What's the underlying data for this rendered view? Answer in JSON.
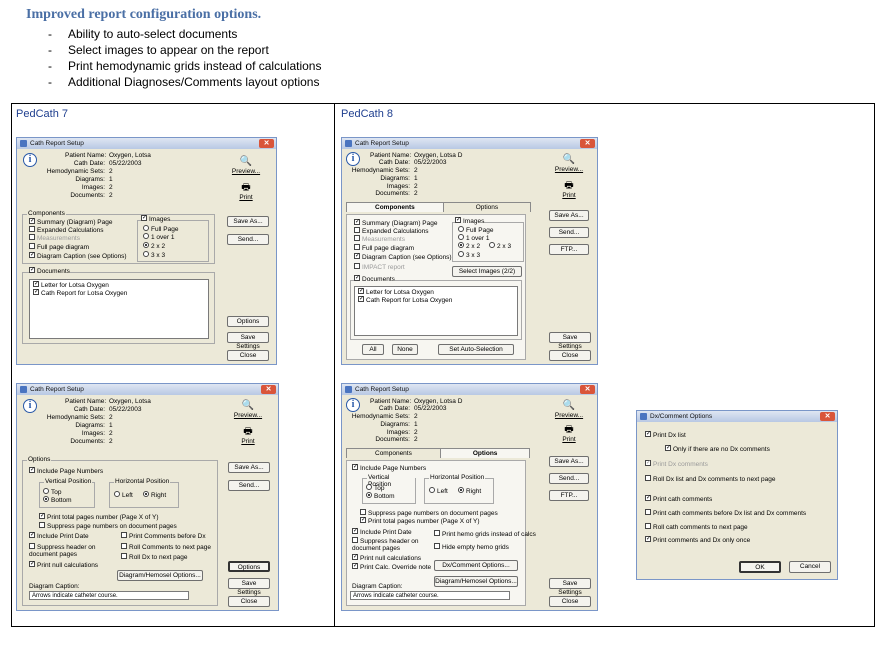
{
  "heading": "Improved report configuration options.",
  "bullets": [
    "Ability to auto-select documents",
    "Select images to appear on the report",
    "Print hemodynamic grids instead of calculations",
    "Additional Diagnoses/Comments layout options"
  ],
  "columns": {
    "left": "PedCath 7",
    "right": "PedCath 8"
  },
  "patient": {
    "name_l": "Patient Name:",
    "name7": "Oxygen, Lotsa",
    "name8": "Oxygen, Lotsa D",
    "date_l": "Cath Date:",
    "date": "05/22/2003",
    "hemo_l": "Hemodynamic Sets:",
    "hemo": "2",
    "diag_l": "Diagrams:",
    "diag": "1",
    "img_l": "Images:",
    "img": "2",
    "doc_l": "Documents:",
    "doc": "2"
  },
  "dialog_title": "Cath Report Setup",
  "buttons": {
    "preview": "Preview...",
    "print": "Print",
    "save_as": "Save As...",
    "send": "Send...",
    "ftp": "FTP...",
    "options": "Options",
    "save_settings": "Save Settings",
    "close": "Close",
    "all": "All",
    "none": "None",
    "auto_sel": "Set Auto-Selection",
    "select_images": "Select Images (2/2)",
    "dx_comment": "Dx/Comment Options...",
    "diag_hemo": "Diagram/Hemosel Options..."
  },
  "components": {
    "group": "Components",
    "summary": "Summary (Diagram) Page",
    "expanded": "Expanded Calculations",
    "measurements": "Measurements",
    "fullpage": "Full page diagram",
    "caption": "Diagram Caption (see Options)",
    "impact": "IMPACT report",
    "images": "Images",
    "full": "Full Page",
    "one": "1 over 1",
    "two": "2 x 2",
    "three": "3 x 3",
    "documents": "Documents",
    "doc1": "Letter for Lotsa Oxygen",
    "doc2": "Cath Report for Lotsa Oxygen"
  },
  "tabs": {
    "components": "Components",
    "options": "Options"
  },
  "options": {
    "group": "Options",
    "include_pn": "Include Page Numbers",
    "vpos": "Vertical Position",
    "hpos": "Horizontal Position",
    "top": "Top",
    "bottom": "Bottom",
    "left": "Left",
    "right": "Right",
    "total": "Print total pages number (Page X of Y)",
    "suppress_pn": "Suppress page numbers on document pages",
    "print_date": "Include Print Date",
    "print_before": "Print Comments before Dx",
    "suppress_hdr": "Suppress header on document pages",
    "roll_comments": "Roll Comments to next page",
    "roll_dx": "Roll Dx to next page",
    "null_calc": "Print null calculations",
    "hemo_grids": "Print hemo grids instead of calcs",
    "hide_hemo": "Hide empty hemo grids",
    "calc_override": "Print Calc. Override note",
    "caption_l": "Diagram Caption:",
    "caption_v": "Arrows indicate catheter course."
  },
  "dx": {
    "title": "Dx/Comment Options",
    "print_dx": "Print Dx list",
    "only_if": "Only if there are no Dx comments",
    "print_dxc": "Print Dx comments",
    "roll_dx": "Roll Dx list and Dx comments to next page",
    "print_cath": "Print cath comments",
    "print_cath_before": "Print cath comments before Dx list and Dx comments",
    "roll_cath": "Roll cath comments to next page",
    "print_once": "Print comments and Dx only once",
    "ok": "OK",
    "cancel": "Cancel"
  }
}
